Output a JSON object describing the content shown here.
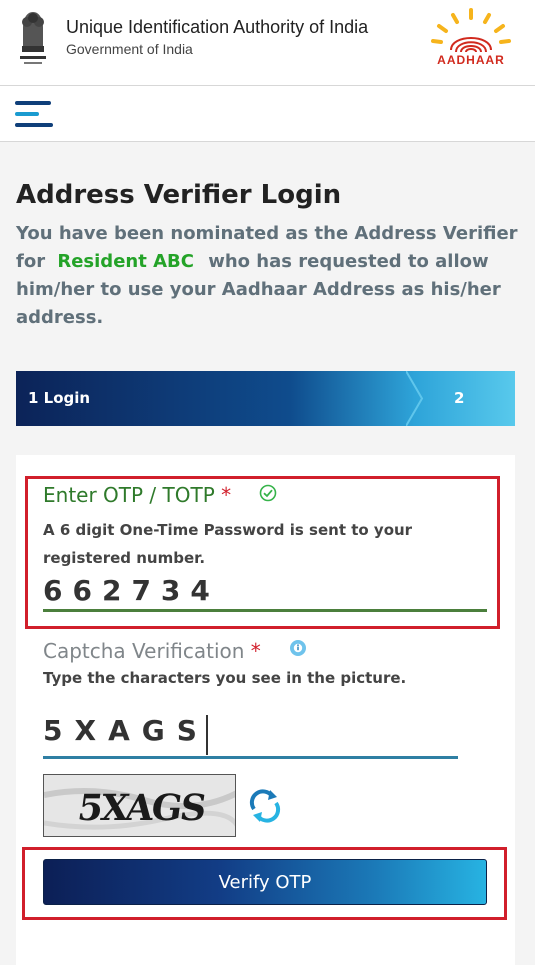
{
  "header": {
    "org_title": "Unique Identification Authority of India",
    "org_subtitle": "Government of India",
    "logo_text": "AADHAAR"
  },
  "nav": {
    "menu_icon": "hamburger-menu-icon"
  },
  "page": {
    "title": "Address Verifier Login",
    "intro_prefix": "You have been nominated as the Address Verifier for",
    "resident_name": "Resident ABC",
    "intro_suffix": "who has requested to allow him/her to use your Aadhaar Address as his/her address."
  },
  "stepper": {
    "step1_label": "1 Login",
    "step2_label": "2"
  },
  "otp": {
    "label": "Enter OTP / TOTP",
    "required_mark": "*",
    "status_icon": "check-circle-icon",
    "help": "A 6 digit One-Time Password is sent to your registered number.",
    "value": "662734"
  },
  "captcha": {
    "label": "Captcha Verification",
    "required_mark": "*",
    "info_icon": "info-icon",
    "help": "Type the characters you see in the picture.",
    "value": "5XAGS",
    "image_text": "5XAGS",
    "refresh_icon": "refresh-icon"
  },
  "verify_button": {
    "label": "Verify OTP"
  },
  "colors": {
    "primary_dark": "#0c1f56",
    "accent_blue": "#27b3e2",
    "success_green": "#24a328",
    "highlight_red": "#d11f2b"
  }
}
